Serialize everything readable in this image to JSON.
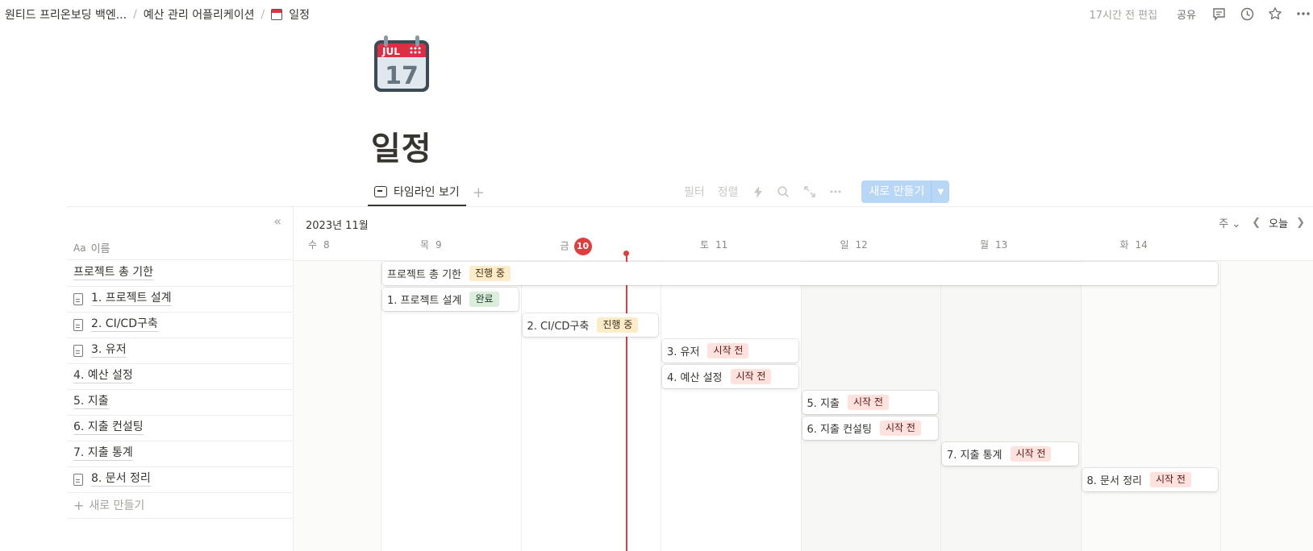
{
  "breadcrumb": {
    "items": [
      "원티드 프리온보딩 백엔...",
      "예산 관리 어플리케이션",
      "일정"
    ]
  },
  "topbar": {
    "edited": "17시간 전 편집",
    "share": "공유"
  },
  "page": {
    "title": "일정",
    "icon": {
      "month": "JUL",
      "day": "17"
    }
  },
  "views": {
    "active_tab": "타임라인 보기"
  },
  "toolbar": {
    "filter": "필터",
    "sort": "정렬",
    "new_label": "새로 만들기"
  },
  "timeline": {
    "month_label": "2023년 11월",
    "scale": "주",
    "today_label": "오늘",
    "name_header": "이름",
    "name_header_prefix": "Aa",
    "new_row_label": "새로 만들기",
    "days": [
      {
        "dow": "수",
        "num": "8"
      },
      {
        "dow": "목",
        "num": "9"
      },
      {
        "dow": "금",
        "num": "10",
        "today": true
      },
      {
        "dow": "토",
        "num": "11"
      },
      {
        "dow": "일",
        "num": "12"
      },
      {
        "dow": "월",
        "num": "13"
      },
      {
        "dow": "화",
        "num": "14"
      }
    ],
    "rows": [
      {
        "name": "프로젝트 총 기한",
        "doc": false,
        "start": "2023-11-09",
        "end": "2023-11-14",
        "status": "진행 중",
        "status_kind": "prog"
      },
      {
        "name": "1. 프로젝트 설계",
        "doc": true,
        "start": "2023-11-09",
        "end": "2023-11-09",
        "status": "완료",
        "status_kind": "done"
      },
      {
        "name": "2. CI/CD구축",
        "doc": true,
        "start": "2023-11-10",
        "end": "2023-11-10",
        "status": "진행 중",
        "status_kind": "prog"
      },
      {
        "name": "3. 유저",
        "doc": true,
        "start": "2023-11-11",
        "end": "2023-11-11",
        "status": "시작 전",
        "status_kind": "todo"
      },
      {
        "name": "4. 예산 설정",
        "doc": false,
        "start": "2023-11-11",
        "end": "2023-11-11",
        "status": "시작 전",
        "status_kind": "todo"
      },
      {
        "name": "5. 지출",
        "doc": false,
        "start": "2023-11-12",
        "end": "2023-11-12",
        "status": "시작 전",
        "status_kind": "todo"
      },
      {
        "name": "6. 지출 컨설팅",
        "doc": false,
        "start": "2023-11-12",
        "end": "2023-11-12",
        "status": "시작 전",
        "status_kind": "todo"
      },
      {
        "name": "7. 지출 통계",
        "doc": false,
        "start": "2023-11-13",
        "end": "2023-11-13",
        "status": "시작 전",
        "status_kind": "todo"
      },
      {
        "name": "8. 문서 정리",
        "doc": true,
        "start": "2023-11-14",
        "end": "2023-11-14",
        "status": "시작 전",
        "status_kind": "todo"
      }
    ]
  },
  "colors": {
    "accent": "#2383e2",
    "today": "#e03e3e",
    "status_prog_bg": "#fdecc8",
    "status_done_bg": "#dbeddb",
    "status_todo_bg": "#ffe2dd"
  }
}
